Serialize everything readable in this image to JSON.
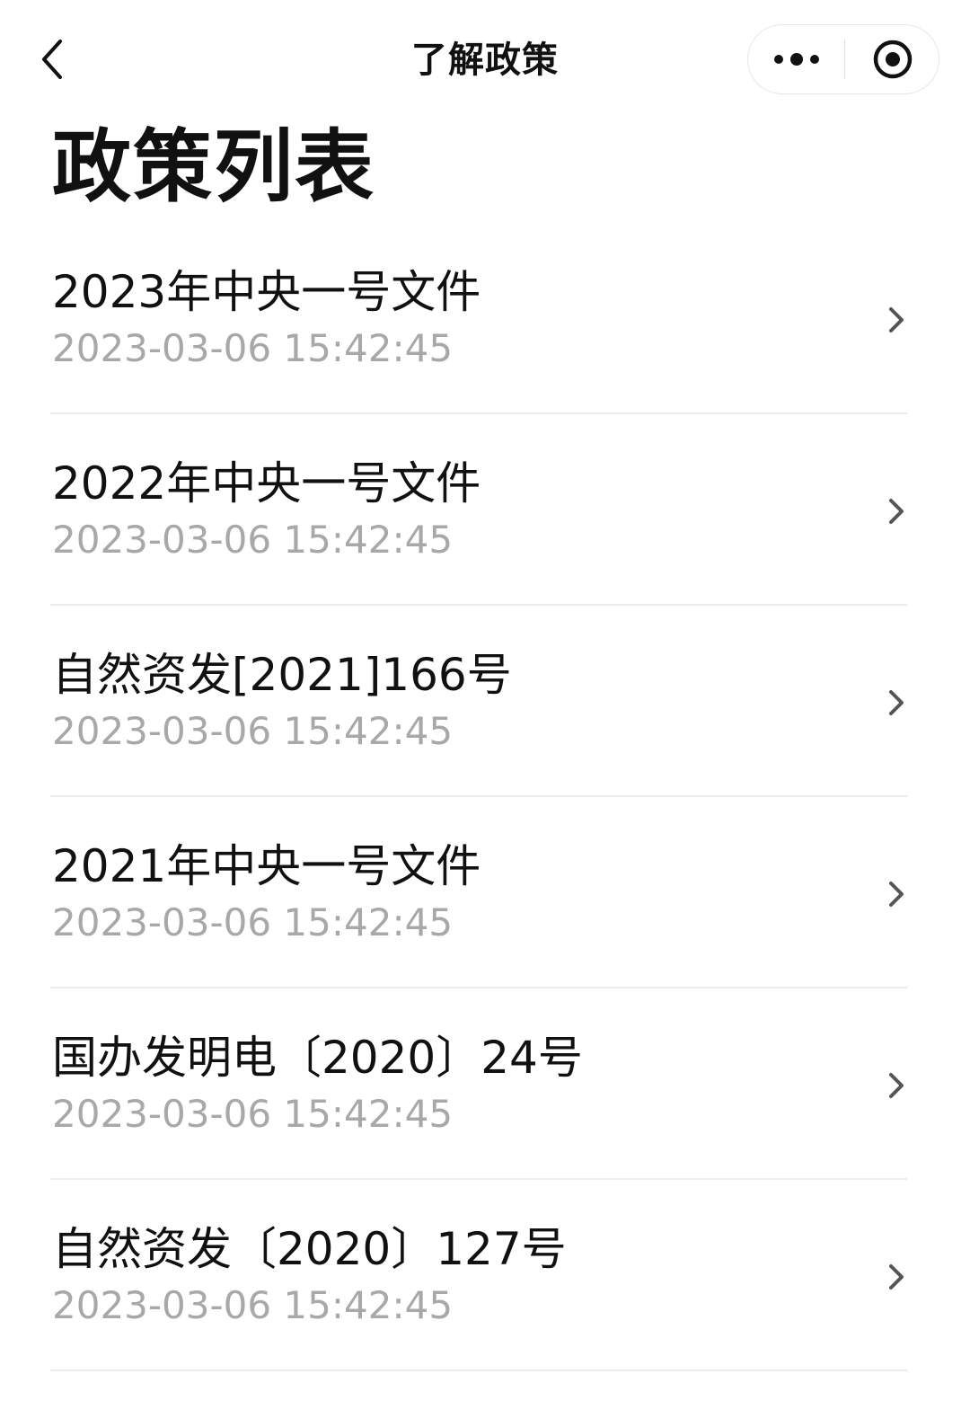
{
  "nav": {
    "title": "了解政策",
    "back_icon": "chevron-left-icon",
    "more_icon": "more-dots-icon",
    "close_icon": "target-circle-icon"
  },
  "page": {
    "title": "政策列表"
  },
  "colors": {
    "title_text": "#111111",
    "secondary_text": "#a8a8a8",
    "divider": "#ececec",
    "chevron": "#555555"
  },
  "policies": [
    {
      "title": "2023年中央一号文件",
      "time": "2023-03-06 15:42:45"
    },
    {
      "title": "2022年中央一号文件",
      "time": "2023-03-06 15:42:45"
    },
    {
      "title": "自然资发[2021]166号",
      "time": "2023-03-06 15:42:45"
    },
    {
      "title": "2021年中央一号文件",
      "time": "2023-03-06 15:42:45"
    },
    {
      "title": "国办发明电〔2020〕24号",
      "time": "2023-03-06 15:42:45"
    },
    {
      "title": "自然资发〔2020〕127号",
      "time": "2023-03-06 15:42:45"
    }
  ]
}
